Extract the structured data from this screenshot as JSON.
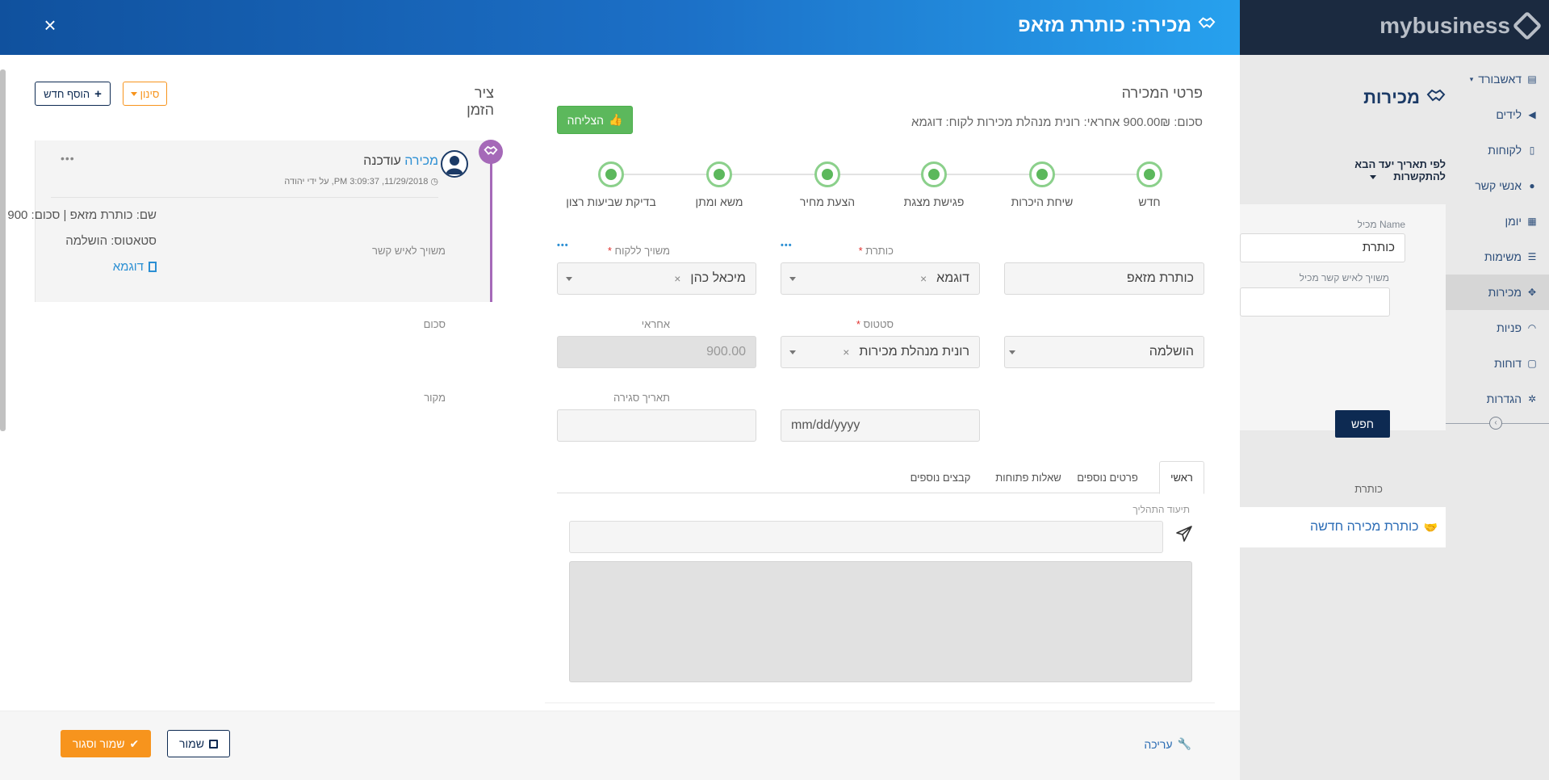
{
  "colors": {
    "header_gradient_start": "#10519e",
    "header_gradient_end": "#27a1ee",
    "navy": "#0d2a52",
    "orange": "#f7941d",
    "green": "#5cb85c",
    "timeline_purple": "#a569b8",
    "link_blue": "#2b8fd3"
  },
  "background_app": {
    "logo": "mybusiness",
    "page_title": "מכירות",
    "sort_label": "לפי תאריך יעד הבא להתקשרות",
    "filter": {
      "name_label": "Name מכיל",
      "name_value": "כותרת",
      "contact_label": "משויך לאיש קשר מכיל"
    },
    "search_button": "חפש",
    "column_header": "כותרת",
    "row_title": "כותרת מכירה חדשה",
    "sidebar": [
      {
        "label": "דאשבורד",
        "icon": "chart-icon"
      },
      {
        "label": "לידים",
        "icon": "megaphone-icon"
      },
      {
        "label": "לקוחות",
        "icon": "building-icon"
      },
      {
        "label": "אנשי קשר",
        "icon": "person-icon"
      },
      {
        "label": "יומן",
        "icon": "calendar-icon"
      },
      {
        "label": "משימות",
        "icon": "list-icon"
      },
      {
        "label": "מכירות",
        "icon": "handshake-icon"
      },
      {
        "label": "פניות",
        "icon": "headset-icon"
      },
      {
        "label": "דוחות",
        "icon": "file-icon"
      },
      {
        "label": "הגדרות",
        "icon": "gear-icon"
      }
    ]
  },
  "modal": {
    "title": "מכירה: כותרת מזאפ",
    "close_glyph": "×",
    "timeline": {
      "title": "ציר הזמן",
      "add_new_label": "הוסף חדש",
      "filter_label": "סינון",
      "entry": {
        "type_link": "מכירה",
        "action": "עודכנה",
        "meta": "11/29/2018, 3:09:37 PM, על ידי יהודה",
        "line1": "שם: כותרת מזאפ | סכום: 900",
        "line2": "סטאטוס: הושלמה",
        "line3": "דוגמא",
        "menu_dots": "•••"
      }
    },
    "details": {
      "title": "פרטי המכירה",
      "summary": "סכום: 900.00₪  אחראי: רונית מנהלת מכירות  לקוח: דוגמא",
      "win_label": "הצליחה",
      "stages": [
        "חדש",
        "שיחת היכרות",
        "פגישת מצגת",
        "הצעת מחיר",
        "משא ומתן",
        "בדיקת שביעות רצון"
      ],
      "fields": {
        "title_label": "כותרת",
        "title_value": "כותרת מזאפ",
        "customer_label": "משויך ללקוח",
        "customer_value": "דוגמא",
        "contact_label": "משויך לאיש קשר",
        "contact_value": "מיכאל כהן",
        "status_label": "סטטוס",
        "status_value": "הושלמה",
        "owner_label": "אחראי",
        "owner_value": "רונית מנהלת מכירות",
        "amount_label": "סכום",
        "amount_value": "900.00",
        "close_date_label": "תאריך סגירה",
        "close_date_placeholder": "mm/dd/yyyy",
        "source_label": "מקור",
        "source_value": "",
        "required_mark": "*",
        "more_dots": "•••",
        "clear_glyph": "×"
      },
      "tabs": [
        "ראשי",
        "פרטים נוספים",
        "שאלות פתוחות",
        "קבצים נוספים"
      ],
      "documentation_label": "תיעוד התהליך"
    },
    "footer": {
      "edit_label": "עריכה",
      "save_label": "שמור",
      "save_close_label": "שמור וסגור"
    }
  }
}
